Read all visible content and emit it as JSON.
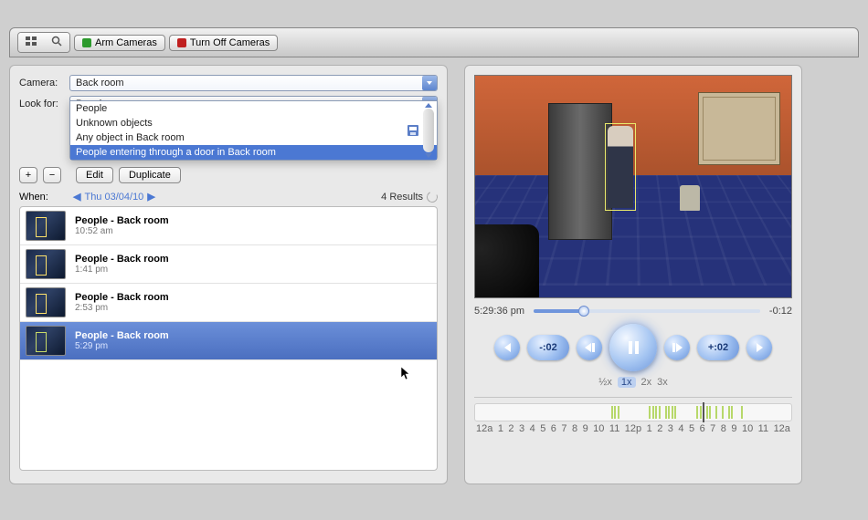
{
  "toolbar": {
    "arm_label": "Arm Cameras",
    "off_label": "Turn Off Cameras"
  },
  "search": {
    "camera_label": "Camera:",
    "camera_value": "Back room",
    "lookfor_label": "Look for:",
    "options": [
      "People",
      "Unknown objects",
      "Any object in Back room",
      "People entering through a door in Back room"
    ],
    "selected_option_index": 3,
    "edit_label": "Edit",
    "duplicate_label": "Duplicate",
    "plus": "+",
    "minus": "−"
  },
  "when": {
    "label": "When:",
    "date": "Thu 03/04/10",
    "results_label": "4 Results"
  },
  "results": [
    {
      "title": "People - Back room",
      "time": "10:52 am"
    },
    {
      "title": "People - Back room",
      "time": "1:41 pm"
    },
    {
      "title": "People - Back room",
      "time": "2:53 pm"
    },
    {
      "title": "People - Back room",
      "time": "5:29 pm"
    }
  ],
  "selected_result_index": 3,
  "player": {
    "current_time": "5:29:36 pm",
    "remaining": "-0:12",
    "skip_back": "-:02",
    "skip_fwd": "+:02",
    "speeds": [
      "½x",
      "1x",
      "2x",
      "3x"
    ],
    "speed_selected_index": 1
  },
  "timeline": {
    "hour_labels": [
      "12a",
      "1",
      "2",
      "3",
      "4",
      "5",
      "6",
      "7",
      "8",
      "9",
      "10",
      "11",
      "12p",
      "1",
      "2",
      "3",
      "4",
      "5",
      "6",
      "7",
      "8",
      "9",
      "10",
      "11",
      "12a"
    ],
    "event_ticks_pct": [
      43,
      44,
      45,
      55,
      56,
      57,
      58,
      60,
      61,
      62,
      63,
      70,
      71,
      72,
      73,
      74,
      76,
      78,
      80,
      81,
      84
    ],
    "playhead_pct": 72
  },
  "colors": {
    "accent": "#4b78d3",
    "highlight": "#6b8fd9"
  }
}
